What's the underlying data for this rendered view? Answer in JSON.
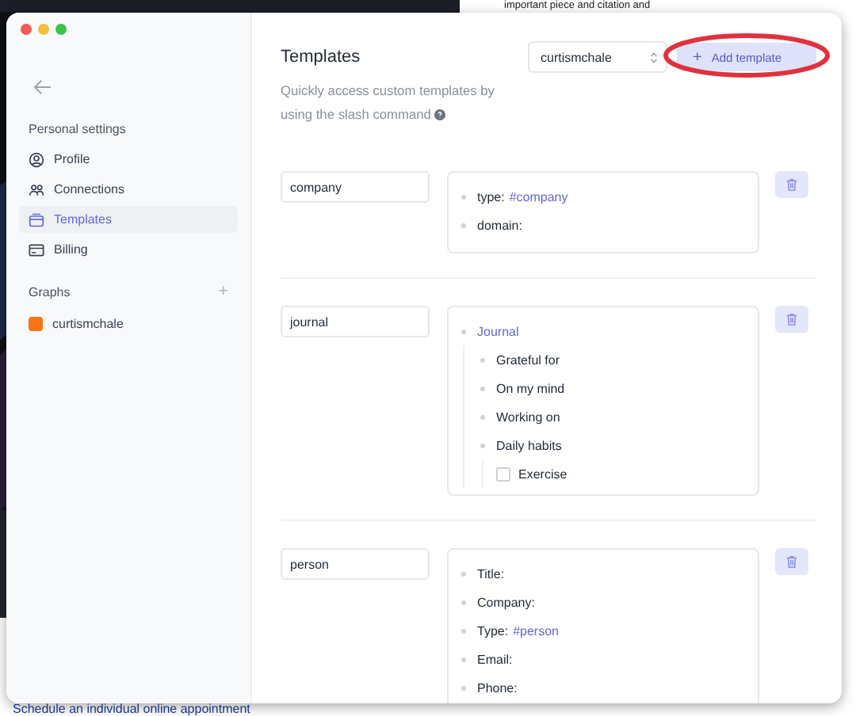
{
  "backdrop": {
    "top_text": "important piece and citation and",
    "bottom_link": "Schedule an individual online appointment"
  },
  "sidebar": {
    "section_title": "Personal settings",
    "items": [
      {
        "label": "Profile",
        "selected": false
      },
      {
        "label": "Connections",
        "selected": false
      },
      {
        "label": "Templates",
        "selected": true
      },
      {
        "label": "Billing",
        "selected": false
      }
    ],
    "graphs_title": "Graphs",
    "add_graph": "+",
    "graphs": [
      {
        "name": "curtismchale",
        "color": "#f97316"
      }
    ]
  },
  "header": {
    "title": "Templates",
    "description": "Quickly access custom templates by using the slash command",
    "graph_select": "curtismchale",
    "add_button": "Add template",
    "add_icon": "+"
  },
  "templates": [
    {
      "name": "company",
      "items": [
        {
          "kind": "text",
          "text": "type:",
          "tag": "#company"
        },
        {
          "kind": "text",
          "text": "domain:"
        }
      ]
    },
    {
      "name": "journal",
      "items": [
        {
          "kind": "heading",
          "text": "Journal",
          "children": [
            {
              "kind": "text",
              "text": "Grateful for"
            },
            {
              "kind": "text",
              "text": "On my mind"
            },
            {
              "kind": "text",
              "text": "Working on"
            },
            {
              "kind": "text",
              "text": "Daily habits",
              "children": [
                {
                  "kind": "checkbox",
                  "text": "Exercise",
                  "checked": false
                }
              ]
            }
          ]
        }
      ]
    },
    {
      "name": "person",
      "items": [
        {
          "kind": "text",
          "text": "Title:"
        },
        {
          "kind": "text",
          "text": "Company:"
        },
        {
          "kind": "text",
          "text": "Type:",
          "tag": "#person"
        },
        {
          "kind": "text",
          "text": "Email:"
        },
        {
          "kind": "text",
          "text": "Phone:"
        }
      ]
    }
  ]
}
